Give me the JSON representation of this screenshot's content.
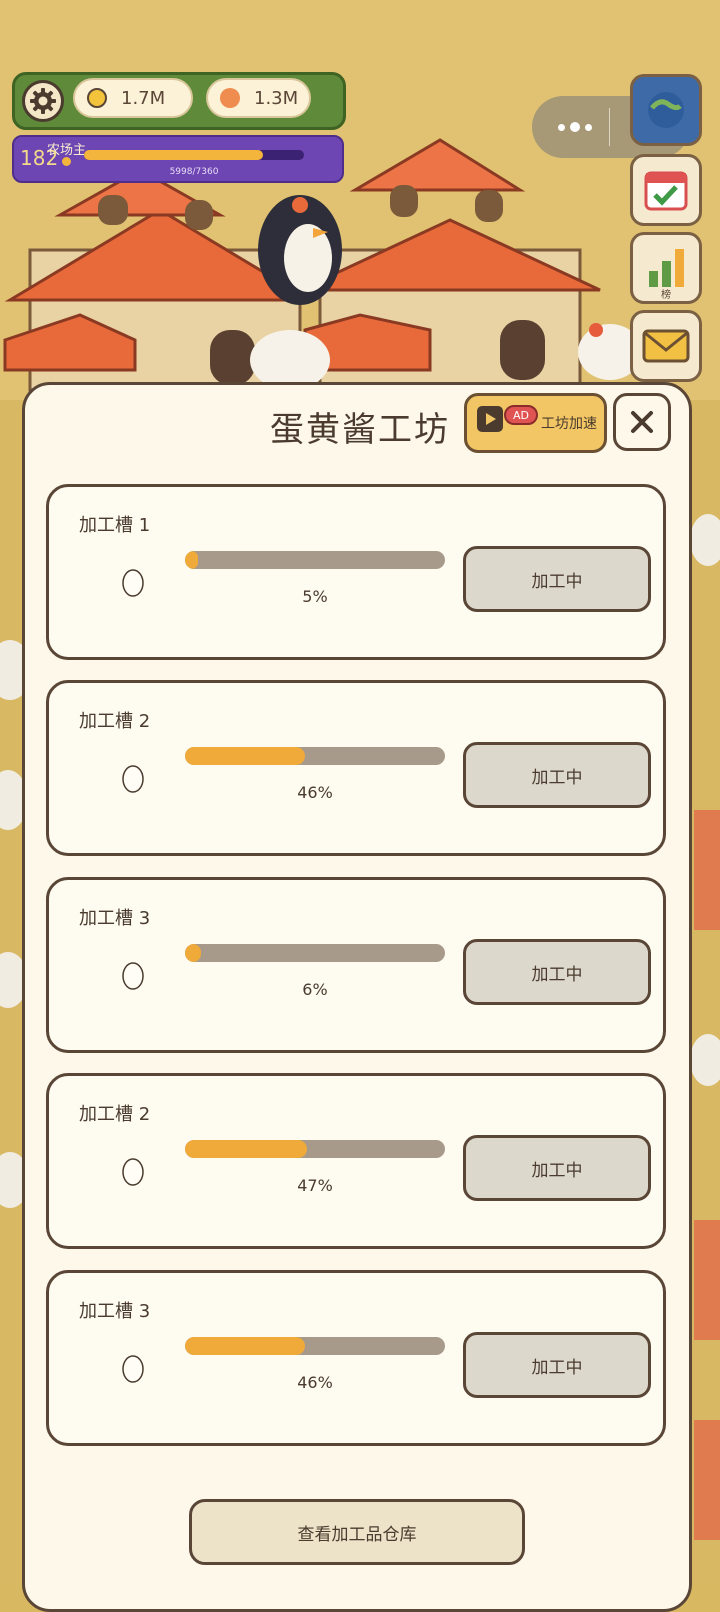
{
  "hud": {
    "coins": "1.7M",
    "gems": "1.3M",
    "level": "182",
    "title": "农场主",
    "xp_text": "5998/7360",
    "xp_progress": 0.815
  },
  "side_buttons": {
    "rank_label": "榜"
  },
  "modal": {
    "title": "蛋黄酱工坊",
    "speed_badge": "AD",
    "speed_label": "工坊加速",
    "warehouse_button": "查看加工品仓库"
  },
  "slots": [
    {
      "name": "加工槽 1",
      "percent_text": "5%",
      "progress": 0.05,
      "status": "加工中"
    },
    {
      "name": "加工槽 2",
      "percent_text": "46%",
      "progress": 0.46,
      "status": "加工中"
    },
    {
      "name": "加工槽 3",
      "percent_text": "6%",
      "progress": 0.06,
      "status": "加工中"
    },
    {
      "name": "加工槽 2",
      "percent_text": "47%",
      "progress": 0.47,
      "status": "加工中"
    },
    {
      "name": "加工槽 3",
      "percent_text": "46%",
      "progress": 0.46,
      "status": "加工中"
    }
  ],
  "colors": {
    "progress_fill": "#efaa3a",
    "progress_track": "#a89a8a",
    "modal_bg": "#fdf8ea",
    "border": "#5a4636"
  }
}
